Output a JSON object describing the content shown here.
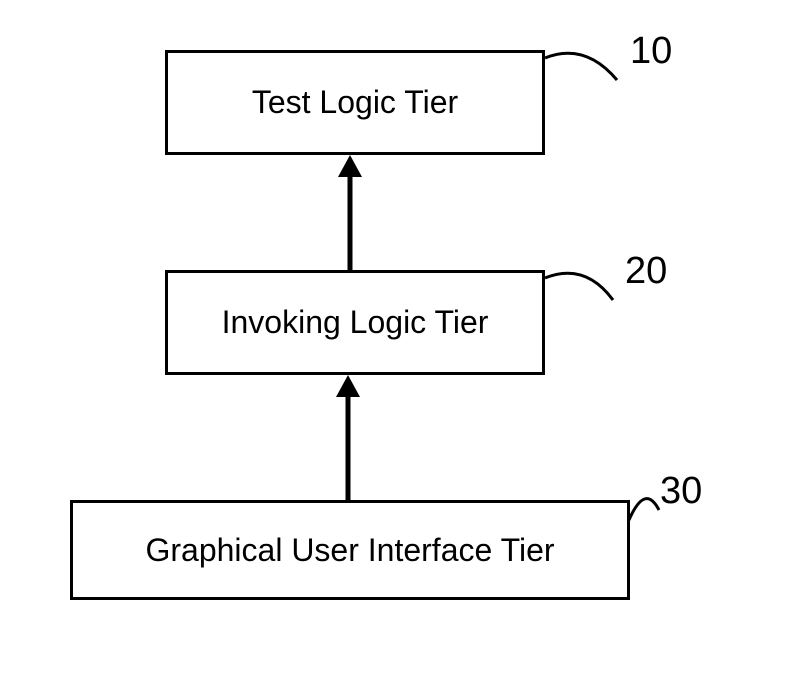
{
  "diagram": {
    "tiers": [
      {
        "id": "10",
        "label": "Test Logic Tier"
      },
      {
        "id": "20",
        "label": "Invoking Logic Tier"
      },
      {
        "id": "30",
        "label": "Graphical User Interface Tier"
      }
    ],
    "labels": {
      "tier_10_number": "10",
      "tier_20_number": "20",
      "tier_30_number": "30"
    }
  }
}
